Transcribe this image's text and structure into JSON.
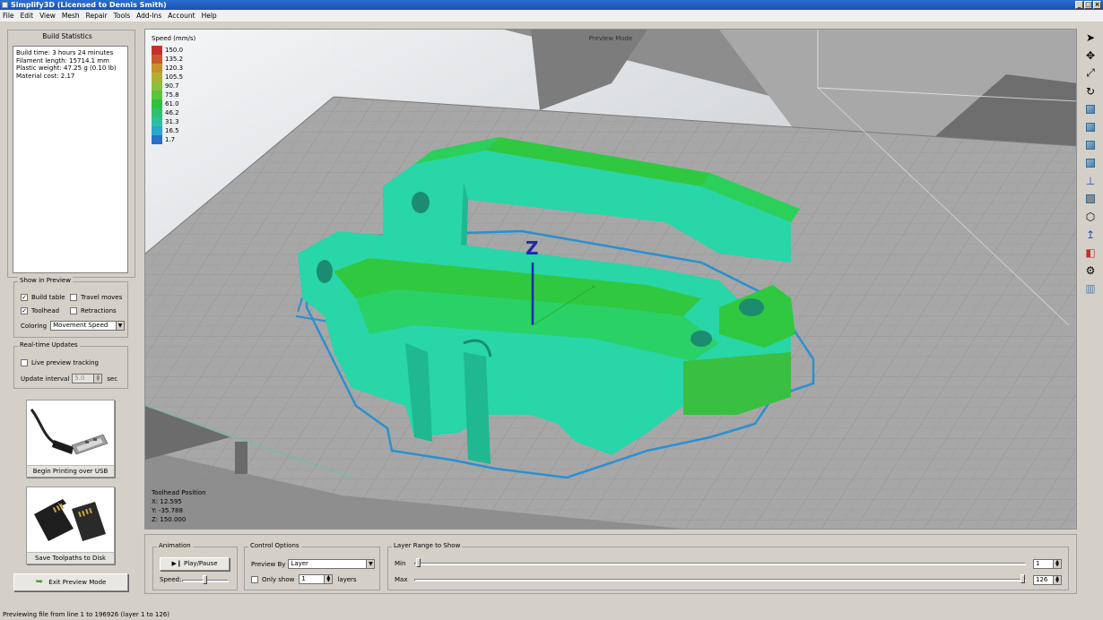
{
  "window": {
    "title": "Simplify3D (Licensed to Dennis Smith)",
    "controls": [
      "_",
      "□",
      "×"
    ]
  },
  "menu": [
    "File",
    "Edit",
    "View",
    "Mesh",
    "Repair",
    "Tools",
    "Add-Ins",
    "Account",
    "Help"
  ],
  "build_stats": {
    "title": "Build Statistics",
    "lines": [
      "Build time: 3 hours 24 minutes",
      "Filament length: 15714.1 mm",
      "Plastic weight: 47.25 g (0.10 lb)",
      "Material cost: 2.17"
    ]
  },
  "show_in_preview": {
    "label": "Show in Preview",
    "build_table": {
      "label": "Build table",
      "checked": true
    },
    "travel_moves": {
      "label": "Travel moves",
      "checked": false
    },
    "toolhead": {
      "label": "Toolhead",
      "checked": true
    },
    "retractions": {
      "label": "Retractions",
      "checked": false
    },
    "coloring_label": "Coloring",
    "coloring_value": "Movement Speed"
  },
  "realtime": {
    "label": "Real-time Updates",
    "live_label": "Live preview tracking",
    "interval_label": "Update interval",
    "interval_value": "5.0",
    "interval_unit": "sec"
  },
  "usb_button": {
    "label": "Begin Printing over USB"
  },
  "sd_button": {
    "label": "Save Toolpaths to Disk"
  },
  "exit_button": {
    "label": "Exit Preview Mode"
  },
  "viewport": {
    "mode_label": "Preview Mode",
    "legend_title": "Speed (mm/s)",
    "legend": [
      {
        "value": "150.0",
        "color": "#c83030"
      },
      {
        "value": "135.2",
        "color": "#c85a30"
      },
      {
        "value": "120.3",
        "color": "#c8902c"
      },
      {
        "value": "105.5",
        "color": "#b0b02c"
      },
      {
        "value": "90.7",
        "color": "#8cc03a"
      },
      {
        "value": "75.8",
        "color": "#5ac43a"
      },
      {
        "value": "61.0",
        "color": "#30c040"
      },
      {
        "value": "46.2",
        "color": "#2ec070"
      },
      {
        "value": "31.3",
        "color": "#2cc0a0"
      },
      {
        "value": "16.5",
        "color": "#2aa8c8"
      },
      {
        "value": "1.7",
        "color": "#2a70c8"
      }
    ],
    "axis_label": "Z",
    "toolhead": {
      "title": "Toolhead Position",
      "x": "X: 12.595",
      "y": "Y: -35.788",
      "z": "Z: 150.000"
    }
  },
  "toolbar_icons": [
    "pointer-icon",
    "move-icon",
    "scale-icon",
    "rotate-icon",
    "view-default-icon",
    "view-front-icon",
    "view-top-icon",
    "view-side-icon",
    "axes-icon",
    "solid-view-icon",
    "wireframe-icon",
    "normals-icon",
    "cross-section-icon",
    "settings-icon",
    "supports-icon"
  ],
  "animation": {
    "label": "Animation",
    "play_label": "Play/Pause",
    "speed_label": "Speed:"
  },
  "control_options": {
    "label": "Control Options",
    "preview_by_label": "Preview By",
    "preview_by_value": "Layer",
    "only_show_label": "Only show",
    "only_show_value": "1",
    "layers_label": "layers"
  },
  "layer_range": {
    "label": "Layer Range to Show",
    "min_label": "Min",
    "min_value": "1",
    "max_label": "Max",
    "max_value": "126"
  },
  "status": "Previewing file from line 1 to 196926 (layer 1 to 126)"
}
